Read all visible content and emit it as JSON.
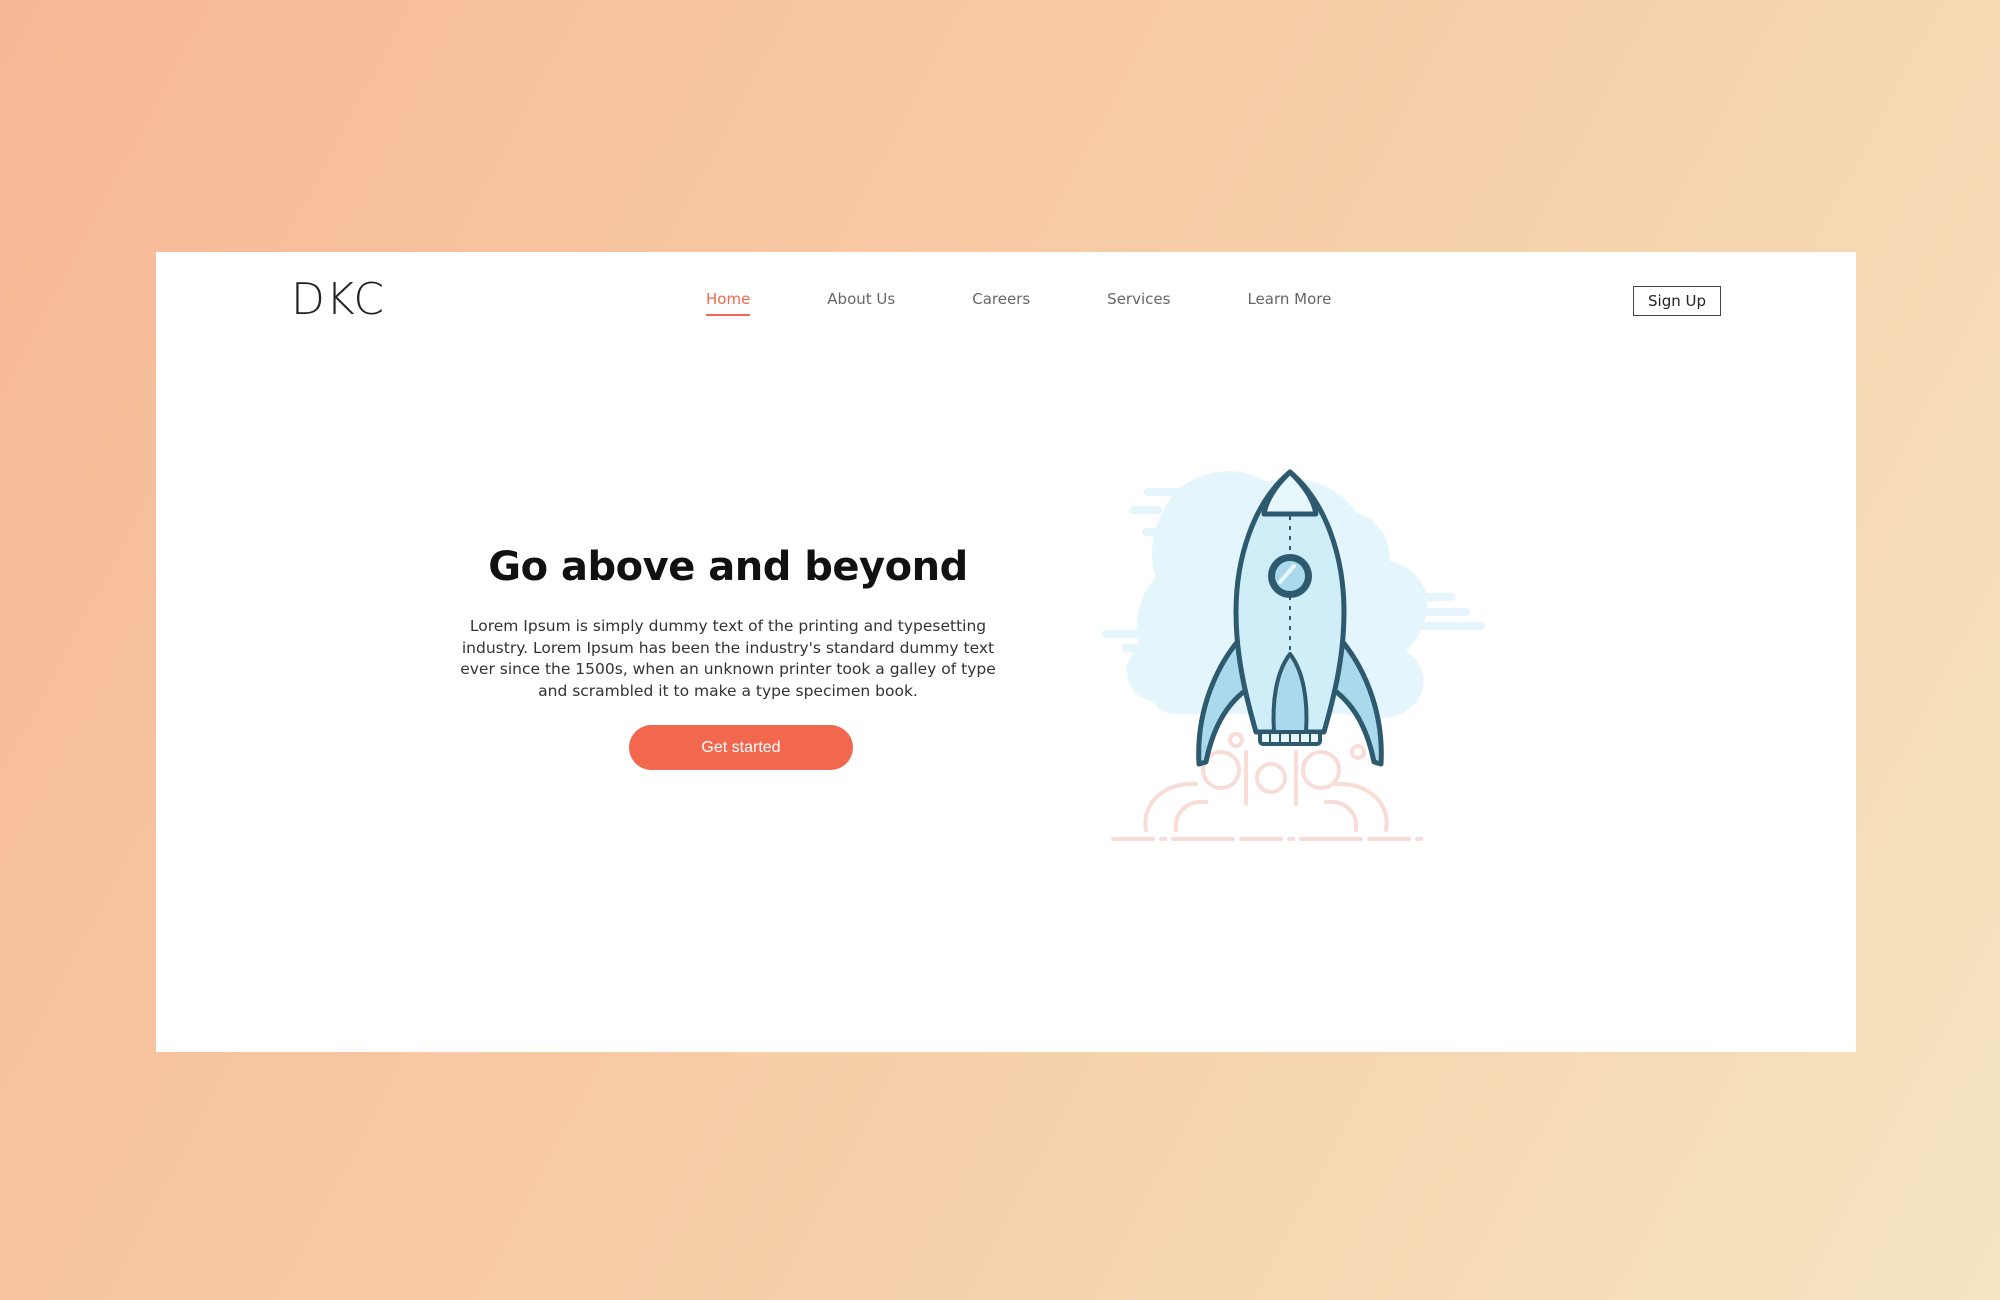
{
  "brand": {
    "logo_text": "DKC"
  },
  "nav": {
    "items": [
      {
        "label": "Home",
        "active": true
      },
      {
        "label": "About Us",
        "active": false
      },
      {
        "label": "Careers",
        "active": false
      },
      {
        "label": "Services",
        "active": false
      },
      {
        "label": "Learn More",
        "active": false
      }
    ]
  },
  "header": {
    "signup_label": "Sign Up"
  },
  "hero": {
    "title": "Go above and beyond",
    "text": "Lorem Ipsum is simply dummy text of the printing and typesetting industry. Lorem Ipsum has been the industry's standard dummy text ever since the 1500s, when an unknown printer took a galley of type and scrambled it to make a type specimen book.",
    "cta_label": "Get started"
  },
  "colors": {
    "accent": "#f2684f",
    "rocket_body": "#cfeef8",
    "rocket_outline": "#2d5a6e",
    "cloud": "#e4f6fc",
    "smoke": "#f8dcd6"
  },
  "icons": {
    "illustration": "rocket-launch-illustration"
  }
}
